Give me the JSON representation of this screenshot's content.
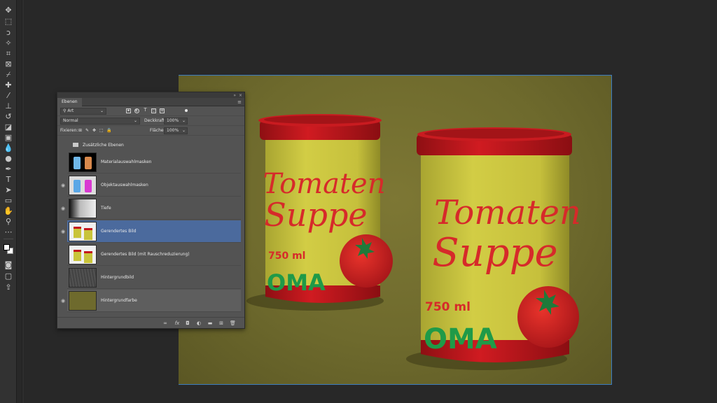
{
  "panel": {
    "tab_label": "Ebenen",
    "filter_label": "Art",
    "blend_mode": "Normal",
    "opacity_label": "Deckkraft:",
    "opacity_value": "100%",
    "lock_label": "Fixieren:",
    "fill_label": "Fläche:",
    "fill_value": "100%"
  },
  "group": {
    "name": "Zusätzliche Ebenen"
  },
  "layers": [
    {
      "name": "Materialauswahlmasken"
    },
    {
      "name": "Objektauswahlmasken"
    },
    {
      "name": "Tiefe"
    },
    {
      "name": "Gerendertes Bild"
    },
    {
      "name": "Gerendertes Bild (mit Rauschreduzierung)"
    },
    {
      "name": "Hintergrundbild"
    },
    {
      "name": "Hintergrundfarbe"
    }
  ],
  "footer": {
    "fx_label": "fx"
  },
  "canvas": {
    "can_left": {
      "line1": "Tomaten",
      "line2": "Suppe",
      "volume": "750 ml",
      "brand": "OMA"
    },
    "can_right": {
      "line1": "Tomaten",
      "line2": "Suppe",
      "volume": "750 ml",
      "brand": "OMA"
    }
  },
  "colors": {
    "selection": "#4b6a9d",
    "canvas_bg": "#6e6a2d",
    "label_yellow": "#c9c43a",
    "lid_red": "#c4161c",
    "text_red": "#d62a2a",
    "brand_green": "#1f9a48"
  }
}
